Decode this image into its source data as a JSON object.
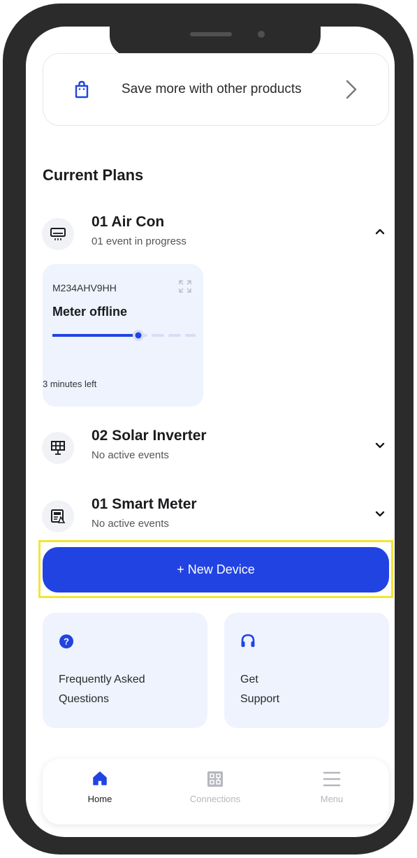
{
  "promo": {
    "text": "Save more with other products"
  },
  "section_title": "Current Plans",
  "plans": [
    {
      "title": "01 Air Con",
      "subtitle": "01 event in progress",
      "expanded": true
    },
    {
      "title": "02 Solar Inverter",
      "subtitle": "No active events",
      "expanded": false
    },
    {
      "title": "01 Smart Meter",
      "subtitle": "No active events",
      "expanded": false
    }
  ],
  "device": {
    "id": "M234AHV9HH",
    "status": "Meter offline",
    "time_left": "3 minutes left",
    "progress": 0.6
  },
  "new_device_label": "+ New Device",
  "help": {
    "faq": {
      "line1": "Frequently Asked",
      "line2": "Questions"
    },
    "support": {
      "line1": "Get",
      "line2": "Support"
    }
  },
  "nav": {
    "items": [
      {
        "label": "Home",
        "icon": "home-icon",
        "active": true
      },
      {
        "label": "Connections",
        "icon": "connections-icon",
        "active": false
      },
      {
        "label": "Menu",
        "icon": "menu-icon",
        "active": false
      }
    ]
  },
  "colors": {
    "accent": "#2143e2",
    "card_bg": "#eef3fd",
    "highlight": "#f3e533",
    "inactive": "#b5b7bd",
    "frame": "#2b2b2b"
  }
}
